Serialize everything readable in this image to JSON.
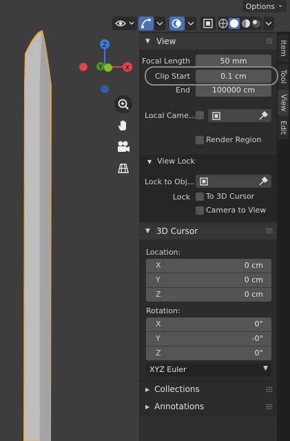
{
  "header": {
    "options_label": "Options",
    "options_chevron": "⌄"
  },
  "gizmo": {
    "z_label": "Z",
    "y_label": "Y",
    "x_label": "X",
    "colors": {
      "x": "#e0424f",
      "y": "#7fbf2a",
      "z": "#3a7bd5"
    }
  },
  "tabs": [
    "Item",
    "Tool",
    "View",
    "Edit"
  ],
  "view_panel": {
    "title": "View",
    "focal_length_label": "Focal Length",
    "focal_length_value": "50 mm",
    "clip_start_label": "Clip Start",
    "clip_start_value": "0.1 cm",
    "clip_end_label": "End",
    "clip_end_value": "100000 cm",
    "local_camera_label": "Local Came...",
    "render_region_label": "Render Region",
    "view_lock": {
      "title": "View Lock",
      "lock_to_object_label": "Lock to Obj...",
      "lock_label": "Lock",
      "to_3d_cursor_label": "To 3D Cursor",
      "camera_to_view_label": "Camera to View"
    }
  },
  "cursor_panel": {
    "title": "3D Cursor",
    "location_label": "Location:",
    "location": [
      {
        "axis": "X",
        "value": "0 cm"
      },
      {
        "axis": "Y",
        "value": "0 cm"
      },
      {
        "axis": "Z",
        "value": "0 cm"
      }
    ],
    "rotation_label": "Rotation:",
    "rotation": [
      {
        "axis": "X",
        "value": "0°"
      },
      {
        "axis": "Y",
        "value": "-0°"
      },
      {
        "axis": "Z",
        "value": "0°"
      }
    ],
    "rotation_mode": "XYZ Euler"
  },
  "collapsed_panels": [
    "Collections",
    "Annotations"
  ],
  "icons": {
    "zoom": "zoom-icon",
    "pan": "hand-icon",
    "camera": "camera-icon",
    "perspective": "grid-icon",
    "eyedropper": "eyedropper-icon"
  },
  "highlight_color": "#8a8a8a",
  "object_outline_color": "#f2a23a"
}
